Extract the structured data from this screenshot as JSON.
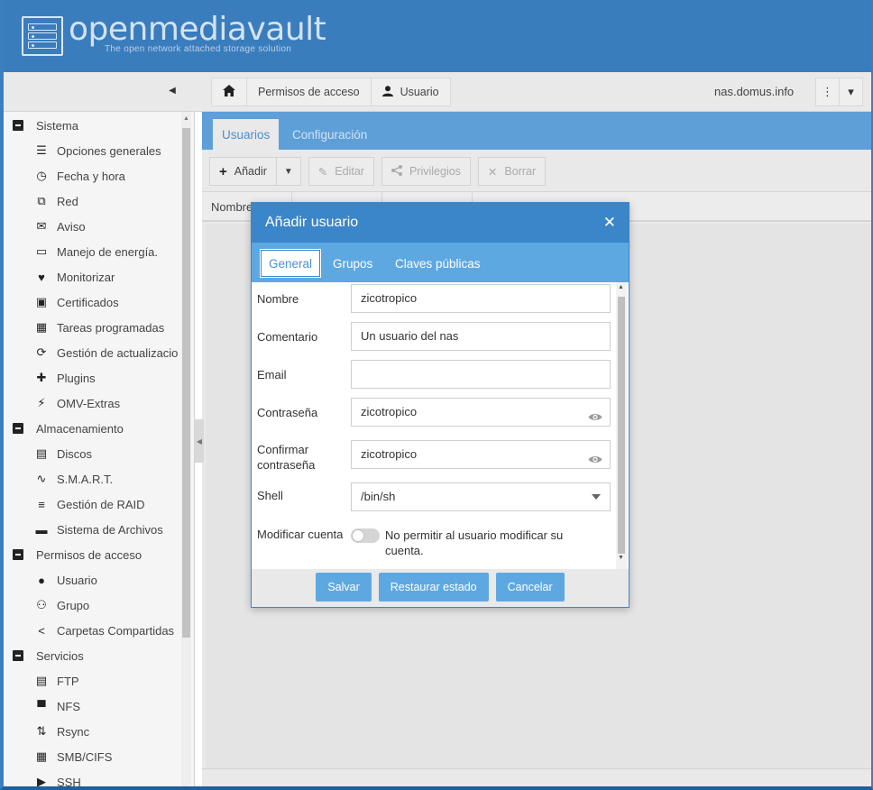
{
  "header": {
    "logo_text": "openmediavault",
    "logo_subtitle": "The open network attached storage solution"
  },
  "breadcrumb": {
    "items": [
      {
        "label": "",
        "icon": "home-icon"
      },
      {
        "label": "Permisos de acceso"
      },
      {
        "label": "Usuario",
        "icon": "user-icon"
      }
    ]
  },
  "hostname": "nas.domus.info",
  "sidebar": {
    "items": [
      {
        "type": "group",
        "label": "Sistema"
      },
      {
        "type": "leaf",
        "label": "Opciones generales",
        "icon": "sliders-icon"
      },
      {
        "type": "leaf",
        "label": "Fecha y hora",
        "icon": "clock-icon"
      },
      {
        "type": "leaf",
        "label": "Red",
        "icon": "network-icon"
      },
      {
        "type": "leaf",
        "label": "Aviso",
        "icon": "envelope-icon"
      },
      {
        "type": "leaf",
        "label": "Manejo de energía.",
        "icon": "battery-icon"
      },
      {
        "type": "leaf",
        "label": "Monitorizar",
        "icon": "heartbeat-icon"
      },
      {
        "type": "leaf",
        "label": "Certificados",
        "icon": "certificate-icon"
      },
      {
        "type": "leaf",
        "label": "Tareas programadas",
        "icon": "calendar-clock-icon"
      },
      {
        "type": "leaf",
        "label": "Gestión de actualizacio",
        "icon": "refresh-icon"
      },
      {
        "type": "leaf",
        "label": "Plugins",
        "icon": "puzzle-icon"
      },
      {
        "type": "leaf",
        "label": "OMV-Extras",
        "icon": "plug-icon"
      },
      {
        "type": "group",
        "label": "Almacenamiento"
      },
      {
        "type": "leaf",
        "label": "Discos",
        "icon": "disk-icon"
      },
      {
        "type": "leaf",
        "label": "S.M.A.R.T.",
        "icon": "pulse-icon"
      },
      {
        "type": "leaf",
        "label": "Gestión de RAID",
        "icon": "database-icon"
      },
      {
        "type": "leaf",
        "label": "Sistema de Archivos",
        "icon": "folder-icon"
      },
      {
        "type": "group",
        "label": "Permisos de acceso"
      },
      {
        "type": "leaf",
        "label": "Usuario",
        "icon": "user-icon"
      },
      {
        "type": "leaf",
        "label": "Grupo",
        "icon": "users-icon"
      },
      {
        "type": "leaf",
        "label": "Carpetas Compartidas",
        "icon": "share-icon"
      },
      {
        "type": "group",
        "label": "Servicios"
      },
      {
        "type": "leaf",
        "label": "FTP",
        "icon": "server-icon"
      },
      {
        "type": "leaf",
        "label": "NFS",
        "icon": "monitor-icon"
      },
      {
        "type": "leaf",
        "label": "Rsync",
        "icon": "sync-icon"
      },
      {
        "type": "leaf",
        "label": "SMB/CIFS",
        "icon": "windows-icon"
      },
      {
        "type": "leaf",
        "label": "SSH",
        "icon": "terminal-icon"
      }
    ]
  },
  "main": {
    "tabs": [
      {
        "label": "Usuarios",
        "active": true
      },
      {
        "label": "Configuración",
        "active": false
      }
    ],
    "actions": {
      "add": "Añadir",
      "edit": "Editar",
      "privileges": "Privilegios",
      "delete": "Borrar"
    },
    "grid_columns": [
      "Nombre",
      "",
      ""
    ]
  },
  "dialog": {
    "title": "Añadir usuario",
    "tabs": [
      {
        "label": "General",
        "active": true
      },
      {
        "label": "Grupos",
        "active": false
      },
      {
        "label": "Claves públicas",
        "active": false
      }
    ],
    "fields": {
      "name_label": "Nombre",
      "name_value": "zicotropico",
      "comment_label": "Comentario",
      "comment_value": "Un usuario del nas",
      "email_label": "Email",
      "email_value": "",
      "password_label": "Contraseña",
      "password_value": "zicotropico",
      "confirm_label": "Confirmar contraseña",
      "confirm_value": "zicotropico",
      "shell_label": "Shell",
      "shell_value": "/bin/sh",
      "modify_label": "Modificar cuenta",
      "modify_text": "No permitir al usuario modificar su cuenta.",
      "modify_enabled": false
    },
    "buttons": {
      "save": "Salvar",
      "reset": "Restaurar estado",
      "cancel": "Cancelar"
    }
  },
  "colors": {
    "header_bg": "#3a7dbd",
    "accent": "#5ea8e1",
    "dialog_title_bg": "#3a86c9"
  }
}
